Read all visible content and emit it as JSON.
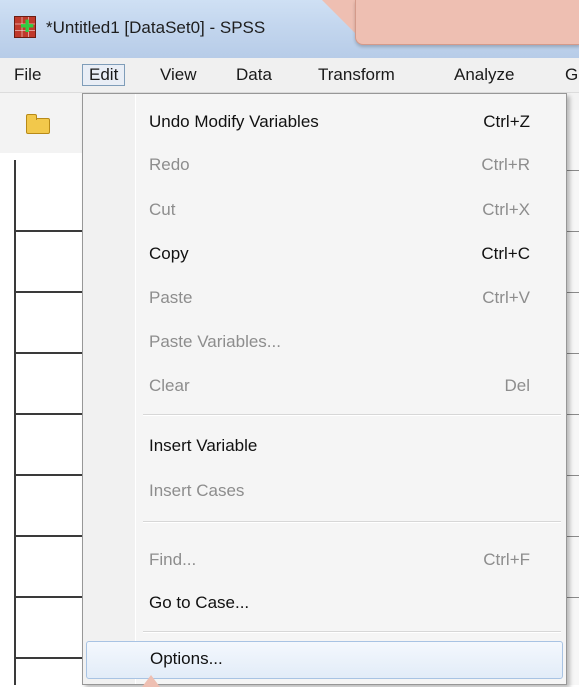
{
  "window": {
    "title": "*Untitled1 [DataSet0] - SPSS",
    "app_icon": "spss-app-icon"
  },
  "menubar": {
    "items": [
      {
        "label": "File"
      },
      {
        "label": "Edit"
      },
      {
        "label": "View"
      },
      {
        "label": "Data"
      },
      {
        "label": "Transform"
      },
      {
        "label": "Analyze"
      },
      {
        "label": "G"
      }
    ],
    "active": "Edit"
  },
  "toolbar": {
    "icons": [
      "open-folder-icon"
    ]
  },
  "edit_menu": {
    "items": [
      {
        "label": "Undo Modify Variables",
        "shortcut": "Ctrl+Z",
        "enabled": true
      },
      {
        "label": "Redo",
        "shortcut": "Ctrl+R",
        "enabled": false
      },
      {
        "label": "Cut",
        "shortcut": "Ctrl+X",
        "enabled": false
      },
      {
        "label": "Copy",
        "shortcut": "Ctrl+C",
        "enabled": true
      },
      {
        "label": "Paste",
        "shortcut": "Ctrl+V",
        "enabled": false
      },
      {
        "label": "Paste Variables...",
        "shortcut": "",
        "enabled": false
      },
      {
        "label": "Clear",
        "shortcut": "Del",
        "enabled": false
      },
      {
        "label": "Insert Variable",
        "shortcut": "",
        "enabled": true
      },
      {
        "label": "Insert Cases",
        "shortcut": "",
        "enabled": false
      },
      {
        "label": "Find...",
        "shortcut": "Ctrl+F",
        "enabled": false
      },
      {
        "label": "Go to Case...",
        "shortcut": "",
        "enabled": true
      },
      {
        "label": "Options...",
        "shortcut": "",
        "enabled": true,
        "highlighted": true
      }
    ]
  },
  "colors": {
    "titlebar": "#c3d6ee",
    "callout": "#eebfb2",
    "menu_background": "#f5f5f5",
    "disabled_text": "#8d8d8d",
    "highlight_border": "#a8c3e3"
  }
}
